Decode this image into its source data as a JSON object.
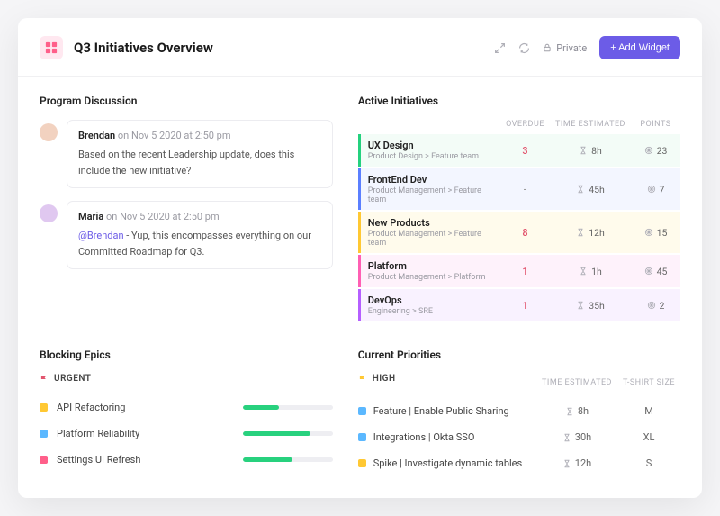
{
  "header": {
    "title": "Q3 Initiatives Overview",
    "private_label": "Private",
    "add_widget_label": "+ Add Widget"
  },
  "discussion": {
    "title": "Program Discussion",
    "comments": [
      {
        "author": "Brendan",
        "time": "on Nov 5 2020 at 2:50 pm",
        "text": "Based on the recent Leadership update, does this include the new initiative?"
      },
      {
        "author": "Maria",
        "time": "on Nov 5 2020 at 2:50 pm",
        "mention": "@Brendan",
        "text": " - Yup, this encompasses everything on our Committed Roadmap for Q3."
      }
    ]
  },
  "initiatives": {
    "title": "Active Initiatives",
    "col_overdue": "OVERDUE",
    "col_time": "TIME ESTIMATED",
    "col_points": "POINTS",
    "rows": [
      {
        "name": "UX Design",
        "path": "Product Design > Feature team",
        "overdue": "3",
        "time": "8h",
        "points": "23"
      },
      {
        "name": "FrontEnd Dev",
        "path": "Product Management > Feature team",
        "overdue": "-",
        "time": "45h",
        "points": "7"
      },
      {
        "name": "New Products",
        "path": "Product Management > Feature team",
        "overdue": "8",
        "time": "12h",
        "points": "15"
      },
      {
        "name": "Platform",
        "path": "Product Management > Platform",
        "overdue": "1",
        "time": "1h",
        "points": "45"
      },
      {
        "name": "DevOps",
        "path": "Engineering > SRE",
        "overdue": "1",
        "time": "35h",
        "points": "2"
      }
    ]
  },
  "blocking": {
    "title": "Blocking Epics",
    "flag_label": "URGENT",
    "rows": [
      {
        "name": "API Refactoring",
        "color": "#ffc833",
        "progress": 40
      },
      {
        "name": "Platform Reliability",
        "color": "#5bb8ff",
        "progress": 75
      },
      {
        "name": "Settings UI Refresh",
        "color": "#ff5f8a",
        "progress": 55
      }
    ]
  },
  "priorities": {
    "title": "Current Priorities",
    "flag_label": "HIGH",
    "col_time": "TIME ESTIMATED",
    "col_size": "T-SHIRT SIZE",
    "rows": [
      {
        "name": "Feature | Enable Public Sharing",
        "color": "#5bb8ff",
        "time": "8h",
        "size": "M"
      },
      {
        "name": "Integrations | Okta SSO",
        "color": "#5bb8ff",
        "time": "30h",
        "size": "XL"
      },
      {
        "name": "Spike | Investigate dynamic tables",
        "color": "#ffc833",
        "time": "12h",
        "size": "S"
      }
    ]
  }
}
